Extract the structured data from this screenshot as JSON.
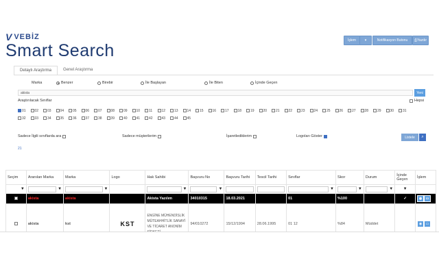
{
  "brand": {
    "small": "VEBİZ",
    "title": "Smart Search"
  },
  "toolbar": {
    "islem": "İşlem",
    "dropdown": "▾",
    "notify": "Notifikasyon Butonu",
    "print": "Yazdır"
  },
  "tabs": [
    {
      "label": "Detaylı Araştırma"
    },
    {
      "label": "Genel Araştırma"
    }
  ],
  "search": {
    "marka_label": "Marka",
    "modes": [
      "Benzer",
      "Birebir",
      "İle Başlayan",
      "İle Biten",
      "İçinde Geçen"
    ],
    "value": "akista",
    "yeni": "Yeni",
    "classes_label": "Araştırılacak Sınıflar",
    "hepsi": "Hepsi"
  },
  "classes": [
    "01",
    "02",
    "03",
    "04",
    "05",
    "06",
    "07",
    "08",
    "09",
    "10",
    "11",
    "12",
    "13",
    "14",
    "15",
    "16",
    "17",
    "18",
    "19",
    "20",
    "21",
    "22",
    "23",
    "24",
    "25",
    "26",
    "27",
    "28",
    "29",
    "30",
    "31",
    "32",
    "33",
    "34",
    "35",
    "36",
    "37",
    "38",
    "39",
    "40",
    "41",
    "42",
    "43",
    "44",
    "45"
  ],
  "options": {
    "opt1": "Sadece İlgili sınıflarda ara",
    "opt2": "Sadece müşterilerim",
    "opt3": "İşaretlediklerim",
    "opt4": "Logoları Göster"
  },
  "listele": "Listele",
  "hash": "21",
  "table": {
    "headers": [
      "Seçim",
      "Aranılan Marka",
      "Marka",
      "Logo",
      "Hak Sahibi",
      "Başvuru No",
      "Başvuru Tarihi",
      "Tescil Tarihi",
      "Sınıflar",
      "Skor",
      "Durum",
      "İçinde Geçen",
      "İşlem"
    ],
    "rows": [
      {
        "aranan": "akista",
        "marka": "akista",
        "logo": "",
        "hak": "Akista Yazılım",
        "basvuru": "34010315",
        "btarih": "18.03.2021",
        "ttarih": "",
        "sinif": "01",
        "skor": "%100",
        "durum": "",
        "icinde": "✓"
      },
      {
        "aranan": "akista",
        "marka": "kst",
        "logo": "KST",
        "hak": "ENGİNE MÜHENDİSLİK MÜTEAHHİTLİK SANAYİ VE TİCARET ANONİM ŞİRKETİ",
        "basvuru": "94/010272",
        "btarih": "15/12/1994",
        "ttarih": "28.06.1995",
        "sinif": "01 12",
        "skor": "%84",
        "durum": "Müddet",
        "icinde": ""
      }
    ]
  }
}
